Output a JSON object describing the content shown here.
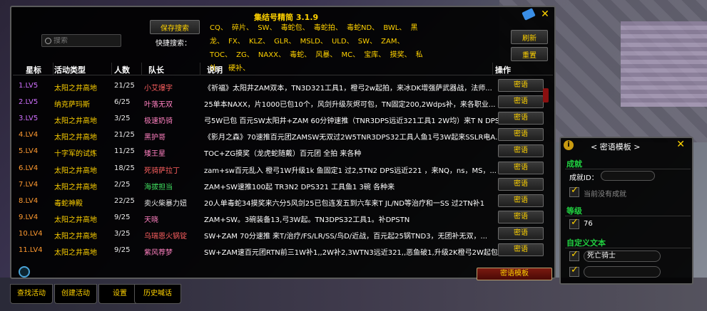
{
  "main": {
    "title": "集结号精简 3.1.9",
    "search_placeholder": "搜索",
    "save_search": "保存搜索",
    "quick_search_label": "快捷搜索：",
    "quick_tags": "CQ、 碎片、 SW、 毒蛇包、 毒蛇拍、 毒蛇ND、 BWL、 黑龙、 FX、 KLZ、 GLR、 MSLD、 ULD、 SW、 ZAM、 TOC、 ZG、 NAXX、 毒蛇、 风暴、 MC、 宝库、 摸奖、 私补、 硬补、",
    "refresh": "刷新",
    "reset": "重置",
    "headers": {
      "star": "星标",
      "activity": "活动类型",
      "count": "人数",
      "leader": "队长",
      "desc": "说明",
      "op": "操作"
    },
    "whisper_label": "密语",
    "template_btn": "密语模板",
    "tabs": [
      "查找活动",
      "创建活动",
      "设置",
      "历史喊话"
    ],
    "rows": [
      {
        "star": "1.LV5",
        "star_color": "#d070ff",
        "activity": "太阳之井高地",
        "count": "21/25",
        "leader": "小艾爆字",
        "leader_color": "#ff6060",
        "desc": "《祈福》太阳井ZAM双本，TN3D321工具1，橙弓2w起拍，来冰DK增强萨武器战，法师..."
      },
      {
        "star": "2.LV5",
        "star_color": "#d070ff",
        "activity": "纳克萨玛斯",
        "count": "6/25",
        "leader": "叶落无双",
        "leader_color": "#ff80c0",
        "desc": "25单本NAXX，片1000已包10个，风剑升级灰烬可包，TN固定200,2Wdps补，来各职业..."
      },
      {
        "star": "3.LV5",
        "star_color": "#d070ff",
        "activity": "太阳之井高地",
        "count": "3/25",
        "leader": "极速奶骑",
        "leader_color": "#ff80c0",
        "desc": "弓5W已包 百元SW太阳井+ZAM 60分钟速推（TNR3DPS远近321工具1 2W均）来T N DPS"
      },
      {
        "star": "4.LV4",
        "star_color": "#ff9a30",
        "activity": "太阳之井高地",
        "count": "21/25",
        "leader": "黑护哥",
        "leader_color": "#ff80c0",
        "desc": "《影月之森》70速推百元团ZAMSW无双过2W5TNR3DPS32工具人鱼1弓3W起来SSLR电A..."
      },
      {
        "star": "5.LV4",
        "star_color": "#ff9a30",
        "activity": "十字军的试炼",
        "count": "11/25",
        "leader": "矮王星",
        "leader_color": "#ff80c0",
        "desc": "TOC+ZG摸奖（龙虎蛇随戴）百元团 全拍 来各种"
      },
      {
        "star": "6.LV4",
        "star_color": "#ff9a30",
        "activity": "太阳之井高地",
        "count": "18/25",
        "leader": "死骑萨拉丁",
        "leader_color": "#ff6060",
        "desc": "zam+sw百元乱入 橙弓1W升级1k 鱼固定1 过2,5TN2 DPS远近221 ，来NQ，ns，MS，..."
      },
      {
        "star": "7.LV4",
        "star_color": "#ff9a30",
        "activity": "太阳之井高地",
        "count": "2/25",
        "leader": "海拔担当",
        "leader_color": "#40e060",
        "desc": "ZAM+SW速推100起  TR3N2 DPS321 工具鱼1 3碗  各种来"
      },
      {
        "star": "8.LV4",
        "star_color": "#ff9a30",
        "activity": "毒蛇神殿",
        "count": "22/25",
        "leader": "卖火柴暴力妞",
        "leader_color": "#e8e8e8",
        "desc": "20人单毒蛇34摸奖来六分5风剑25已包连发五到六车来T JL/ND等治疗和一SS 过2TN补1"
      },
      {
        "star": "9.LV4",
        "star_color": "#ff9a30",
        "activity": "太阳之井高地",
        "count": "9/25",
        "leader": "天晓",
        "leader_color": "#ff80c0",
        "desc": "ZAM+SW。3碗装备13,弓3W起。TN3DPS32工具1。补DPSTN"
      },
      {
        "star": "10.LV4",
        "star_color": "#ff9a30",
        "activity": "太阳之井高地",
        "count": "3/25",
        "leader": "乌瑞恩火锅锭",
        "leader_color": "#ff6060",
        "desc": "SW+ZAM 70分速推 来T/治疗/FS/LR/SS/鸟D/近战，百元起25锅TND3，无团补无双，..."
      },
      {
        "star": "11.LV4",
        "star_color": "#ff9a30",
        "activity": "太阳之井高地",
        "count": "9/25",
        "leader": "紫风荐梦",
        "leader_color": "#ff80c0",
        "desc": "SW+ZAM速百元团RTN前三1W补1,,2W补2,3WTN3远近321,,恶鱼破1,升级2K橙弓2W起包"
      }
    ]
  },
  "side": {
    "title": "< 密语模板 >",
    "achievement_section": "成就",
    "achievement_id_label": "成就ID：",
    "no_achievement": "当前没有成就",
    "level_section": "等级",
    "level_value": "76",
    "custom_section": "自定义文本",
    "custom_text_1": "死亡骑士",
    "custom_text_2": ""
  }
}
